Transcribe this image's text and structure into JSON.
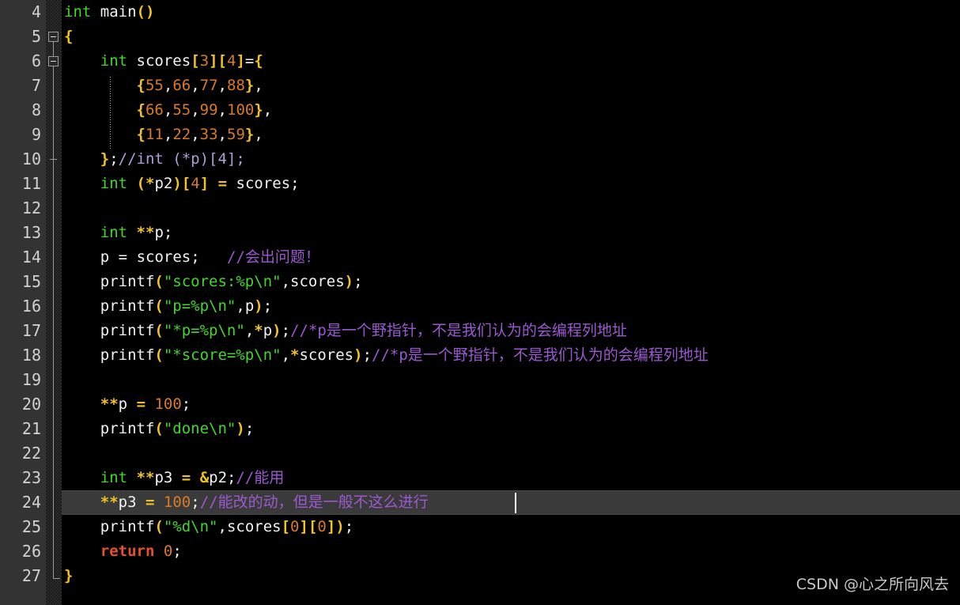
{
  "editor": {
    "theme_name": "dark-plus-c",
    "background": "#000000",
    "gutter_background": "#333333",
    "current_line_background": "#3a3a3a",
    "first_line_number": 4,
    "last_line_number": 27,
    "current_line_number": 24,
    "caret_line": 24,
    "language": "C"
  },
  "colors": {
    "keyword": "#44d62c",
    "return_keyword": "#e8502a",
    "identifier": "#f2f2f2",
    "operator": "#f2c320",
    "number": "#d97a28",
    "string": "#44d62c",
    "comment": "#9b59d0",
    "comment_light": "#b39ddb",
    "line_number": "#d2d2d2",
    "caret": "#ffffff"
  },
  "line_numbers": [
    "4",
    "5",
    "6",
    "7",
    "8",
    "9",
    "10",
    "11",
    "12",
    "13",
    "14",
    "15",
    "16",
    "17",
    "18",
    "19",
    "20",
    "21",
    "22",
    "23",
    "24",
    "25",
    "26",
    "27"
  ],
  "code_lines": [
    {
      "number": "4",
      "text": "int main()"
    },
    {
      "number": "5",
      "text": "{"
    },
    {
      "number": "6",
      "text": "    int scores[3][4]={"
    },
    {
      "number": "7",
      "text": "        {55,66,77,88},"
    },
    {
      "number": "8",
      "text": "        {66,55,99,100},"
    },
    {
      "number": "9",
      "text": "        {11,22,33,59},"
    },
    {
      "number": "10",
      "text": "    };//int (*p)[4];"
    },
    {
      "number": "11",
      "text": "    int (*p2)[4] = scores;"
    },
    {
      "number": "12",
      "text": ""
    },
    {
      "number": "13",
      "text": "    int **p;"
    },
    {
      "number": "14",
      "text": "    p = scores;   //会出问题！"
    },
    {
      "number": "15",
      "text": "    printf(\"scores:%p\\n\",scores);"
    },
    {
      "number": "16",
      "text": "    printf(\"p=%p\\n\",p);"
    },
    {
      "number": "17",
      "text": "    printf(\"*p=%p\\n\",*p);//*p是一个野指针，不是我们认为的会编程列地址"
    },
    {
      "number": "18",
      "text": "    printf(\"*score=%p\\n\",*scores);//*p是一个野指针，不是我们认为的会编程列地址"
    },
    {
      "number": "19",
      "text": ""
    },
    {
      "number": "20",
      "text": "    **p = 100;"
    },
    {
      "number": "21",
      "text": "    printf(\"done\\n\");"
    },
    {
      "number": "22",
      "text": ""
    },
    {
      "number": "23",
      "text": "    int **p3 = &p2;//能用"
    },
    {
      "number": "24",
      "text": "    **p3 = 100;//能改的动，但是一般不这么进行"
    },
    {
      "number": "25",
      "text": "    printf(\"%d\\n\",scores[0][0]);"
    },
    {
      "number": "26",
      "text": "    return 0;"
    },
    {
      "number": "27",
      "text": "}"
    }
  ],
  "tokens": {
    "l4": {
      "kw": "int",
      "sp": " ",
      "id": "main",
      "op_open": "(",
      "op_close": ")"
    },
    "l5": {
      "brace": "{"
    },
    "l6": {
      "kw": "int",
      "id": "scores",
      "b1": "[",
      "n1": "3",
      "b2": "]",
      "b3": "[",
      "n2": "4",
      "b4": "]",
      "eq": "=",
      "brace": "{"
    },
    "l7": {
      "open": "{",
      "v1": "55",
      "v2": "66",
      "v3": "77",
      "v4": "88",
      "close": "}",
      "comma": ","
    },
    "l8": {
      "open": "{",
      "v1": "66",
      "v2": "55",
      "v3": "99",
      "v4": "100",
      "close": "}",
      "comma": ","
    },
    "l9": {
      "open": "{",
      "v1": "11",
      "v2": "22",
      "v3": "33",
      "v4": "59",
      "close": "}",
      "comma": ","
    },
    "l10": {
      "close": "}",
      "semi": ";",
      "comment": "//int (*p)[4];"
    },
    "l11": {
      "kw": "int",
      "op1": "(",
      "star": "*",
      "id": "p2",
      "op2": ")",
      "b1": "[",
      "n": "4",
      "b2": "]",
      "eq": "=",
      "id2": "scores",
      "semi": ";"
    },
    "l13": {
      "kw": "int",
      "stars": "**",
      "id": "p",
      "semi": ";"
    },
    "l14": {
      "id": "p",
      "eq": "=",
      "id2": "scores",
      "semi": ";",
      "gap": "   ",
      "comment": "//会出问题！"
    },
    "l15": {
      "fn": "printf",
      "op": "(",
      "str": "\"scores:%p\\n\"",
      "comma": ",",
      "arg": "scores",
      "cp": ")",
      "semi": ";"
    },
    "l16": {
      "fn": "printf",
      "op": "(",
      "str": "\"p=%p\\n\"",
      "comma": ",",
      "arg": "p",
      "cp": ")",
      "semi": ";"
    },
    "l17": {
      "fn": "printf",
      "op": "(",
      "str": "\"*p=%p\\n\"",
      "comma": ",",
      "star": "*",
      "arg": "p",
      "cp": ")",
      "semi": ";",
      "comment": "//*p是一个野指针，不是我们认为的会编程列地址"
    },
    "l18": {
      "fn": "printf",
      "op": "(",
      "str": "\"*score=%p\\n\"",
      "comma": ",",
      "star": "*",
      "arg": "scores",
      "cp": ")",
      "semi": ";",
      "comment": "//*p是一个野指针，不是我们认为的会编程列地址"
    },
    "l20": {
      "stars": "**",
      "id": "p",
      "eq": "=",
      "num": "100",
      "semi": ";"
    },
    "l21": {
      "fn": "printf",
      "op": "(",
      "str": "\"done\\n\"",
      "cp": ")",
      "semi": ";"
    },
    "l23": {
      "kw": "int",
      "stars": "**",
      "id": "p3",
      "eq": "=",
      "amp": "&",
      "id2": "p2",
      "semi": ";",
      "comment": "//能用"
    },
    "l24": {
      "stars": "**",
      "id": "p3",
      "eq": "=",
      "num": "100",
      "semi": ";",
      "comment": "//能改的动，但是一般不这么进行"
    },
    "l25": {
      "fn": "printf",
      "op": "(",
      "str": "\"%d\\n\"",
      "comma": ",",
      "arg": "scores",
      "b1": "[",
      "n1": "0",
      "b2": "]",
      "b3": "[",
      "n2": "0",
      "b4": "]",
      "cp": ")",
      "semi": ";"
    },
    "l26": {
      "kw": "return",
      "num": "0",
      "semi": ";"
    },
    "l27": {
      "brace": "}"
    }
  },
  "fold_markers": [
    {
      "line": "5",
      "type": "collapse-box"
    },
    {
      "line": "6",
      "type": "collapse-box"
    },
    {
      "line": "10",
      "type": "fold-end-tick"
    },
    {
      "line": "27",
      "type": "fold-end-corner"
    }
  ],
  "watermark": {
    "text": "CSDN @心之所向风去"
  }
}
